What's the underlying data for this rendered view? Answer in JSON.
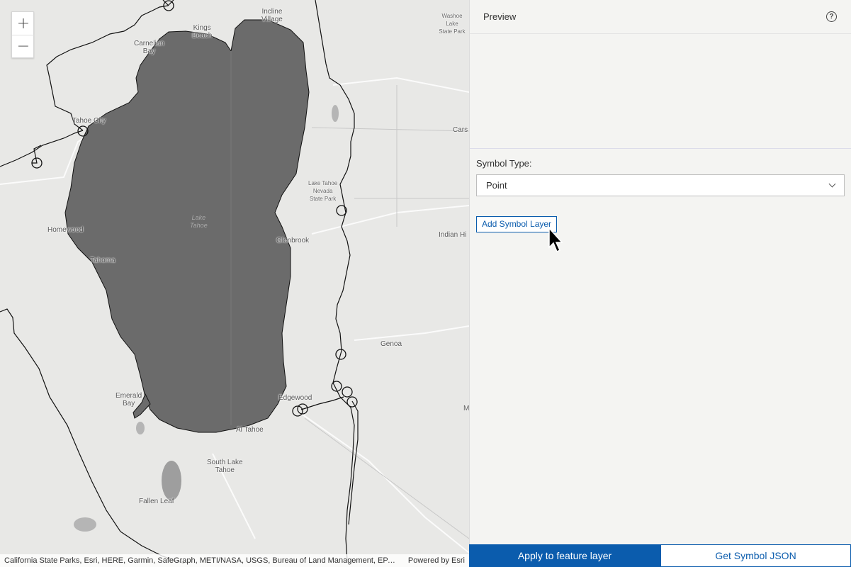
{
  "map": {
    "zoom_in": "+",
    "zoom_out": "−",
    "places": {
      "incline": "Incline\nVillage",
      "washoe": "Washoe Lake\nState Park",
      "kings": "Kings\nBeach",
      "carnelian": "Carnelian\nBay",
      "tahoe_city": "Tahoe City",
      "carson": "Cars",
      "lake_tahoe_park": "Lake Tahoe\nNevada\nState Park",
      "lake": "Lake\nTahoe",
      "homewood": "Homewood",
      "glenbrook": "Glenbrook",
      "indian_hills": "Indian Hi",
      "tahoma": "Tahoma",
      "genoa": "Genoa",
      "emerald": "Emerald\nBay",
      "edgewood": "Edgewood",
      "al_tahoe": "Al Tahoe",
      "south_lake": "South Lake\nTahoe",
      "fallen_leaf": "Fallen Leaf",
      "m": "M"
    },
    "attribution": "California State Parks, Esri, HERE, Garmin, SafeGraph, METI/NASA, USGS, Bureau of Land Management, EPA, NPS, USDA",
    "powered_by": "Powered by Esri"
  },
  "panel": {
    "title": "Preview",
    "help_icon": "?",
    "symbol_type_label": "Symbol Type:",
    "symbol_type_value": "Point",
    "add_layer_label": "Add Symbol Layer",
    "apply_label": "Apply to feature layer",
    "json_label": "Get Symbol JSON"
  },
  "colors": {
    "accent": "#0b5cad",
    "lake_fill": "#6b6b6b",
    "map_bg": "#e8e8e6"
  }
}
